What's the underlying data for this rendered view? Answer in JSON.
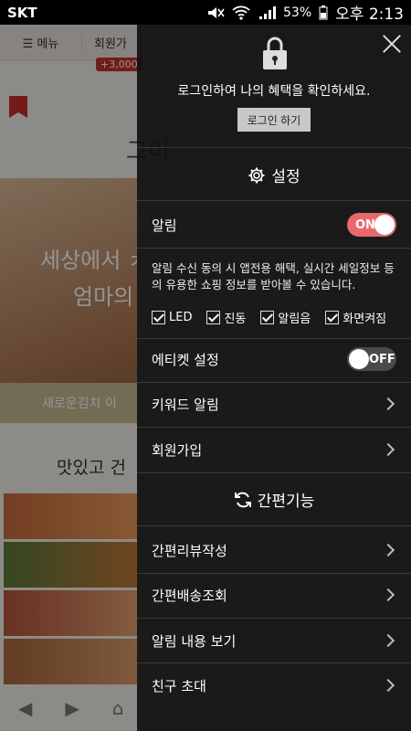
{
  "status_bar": {
    "carrier": "SKT",
    "battery": "53%",
    "time": "오후 2:13"
  },
  "background": {
    "menu_label": "☰ 메뉴",
    "join_label": "회원가",
    "badge": "+3,000",
    "logo": "그어",
    "hero_line1": "세상에서 ㅊ",
    "hero_line2": "엄마의",
    "bar_label": "새로운김치 이",
    "tagline": "맛있고 건"
  },
  "drawer": {
    "lock_message": "로그인하여 나의 혜택을 확인하세요.",
    "login_button": "로그인 하기",
    "settings_title": "설정",
    "alarm": {
      "label": "알림",
      "toggle": "ON"
    },
    "alarm_description": "알림 수신 동의 시 앱전용 해택, 실시간 세일정보 등의 유용한 쇼핑 정보를 받아볼 수 있습니다.",
    "checkboxes": [
      {
        "label": "LED"
      },
      {
        "label": "진동"
      },
      {
        "label": "알림음"
      },
      {
        "label": "화면켜짐"
      }
    ],
    "etiquette": {
      "label": "에티켓 설정",
      "toggle": "OFF"
    },
    "keyword_alarm": "키워드 알림",
    "signup": "회원가입",
    "quick_title": "간편기능",
    "quick_items": [
      {
        "label": "간편리뷰작성"
      },
      {
        "label": "간편배송조회"
      },
      {
        "label": "알림 내용 보기"
      },
      {
        "label": "친구 초대"
      }
    ]
  }
}
